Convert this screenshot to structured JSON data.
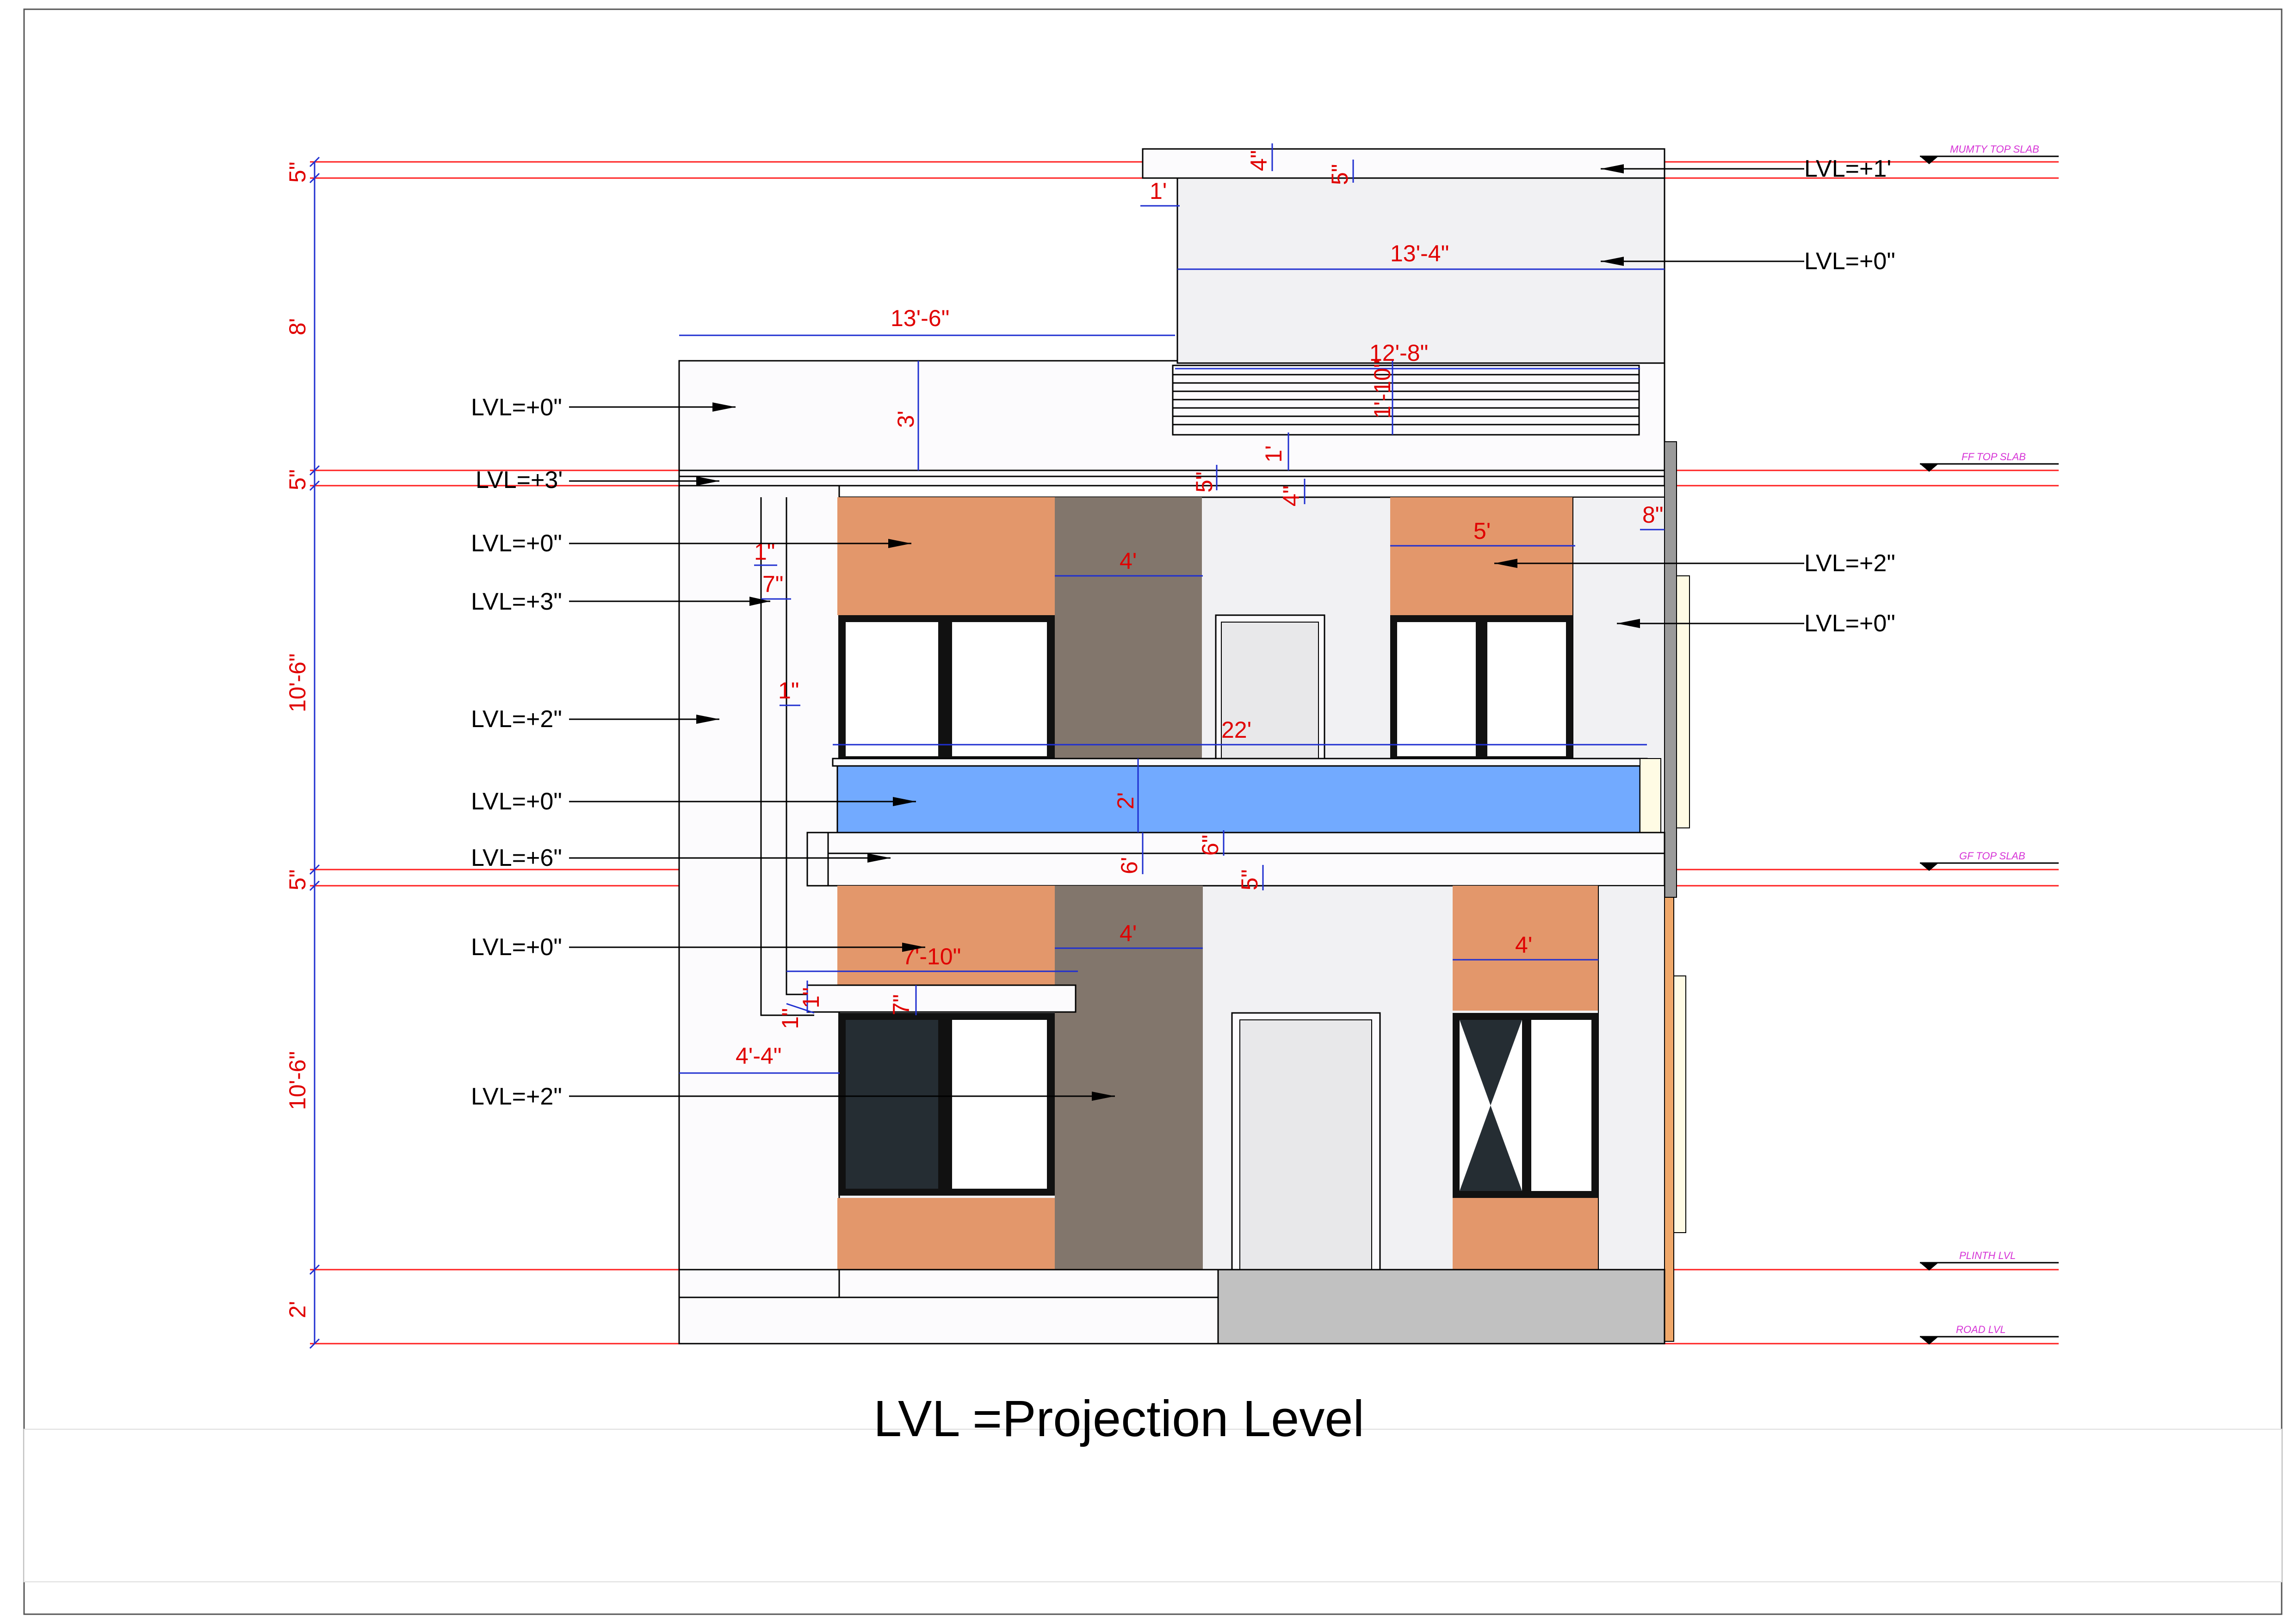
{
  "colors": {
    "wall": "#fcfbfd",
    "light_wall": "#f1f1f3",
    "orange_cladding": "#e3976b",
    "brown_cladding": "#82766c",
    "glass_rail": "#72aaff",
    "plinth_grey": "#c1c1c1",
    "dim_line": "#1f2fd0",
    "dim_text": "#e00000",
    "level_line": "#ff2020",
    "tag_text": "#d633d6",
    "window_frame": "#111111",
    "dark_glass": "#252d33"
  },
  "level_tags": {
    "mumty": "MUMTY TOP SLAB",
    "ff": "FF TOP SLAB",
    "gf": "GF TOP SLAB",
    "plinth": "PLINTH LVL",
    "road": "ROAD LVL"
  },
  "left_dims": {
    "d1": "5\"",
    "d2": "8'",
    "d3": "5\"",
    "d4": "10'-6\"",
    "d5": "5\"",
    "d6": "10'-6\"",
    "d7": "2'"
  },
  "left_labels": {
    "l1": "LVL=+0\"",
    "l2": "LVL=+3'",
    "l3": "LVL=+0\"",
    "l4": "LVL=+3\"",
    "l5": "LVL=+2\"",
    "l6": "LVL=+0\"",
    "l7": "LVL=+6\"",
    "l8": "LVL=+0\"",
    "l9": "LVL=+2\""
  },
  "right_labels": {
    "r1": "LVL=+1'",
    "r2": "LVL=+0\"",
    "r3": "LVL=+2\"",
    "r4": "LVL=+0\""
  },
  "dims": {
    "mumty_slab": "4\"",
    "mumty_5": "5\"",
    "mumty_1": "1'",
    "mumty_width": "13'-4\"",
    "left_width": "13'-6\"",
    "louver_width": "12'-8\"",
    "louver_height": "1'-10\"",
    "parapet": "3'",
    "slab_1": "1'",
    "slab_5": "5\"",
    "slab_4": "4\"",
    "side_8": "8\"",
    "ff_5": "5'",
    "ff_4": "4'",
    "pipe_1a": "1\"",
    "pipe_7": "7\"",
    "pipe_1b": "1\"",
    "balcony": "22'",
    "rail": "2'",
    "balc_6a": "6'",
    "balc_6b": "6\"",
    "gf_slab": "5\"",
    "gf_4a": "4'",
    "gf_4b": "4'",
    "sunshade": "7'-10\"",
    "sun_1a": "1\"",
    "sun_1b": "1\"",
    "sun_7": "7\"",
    "setback": "4'-4\""
  },
  "caption": "LVL =Projection Level"
}
